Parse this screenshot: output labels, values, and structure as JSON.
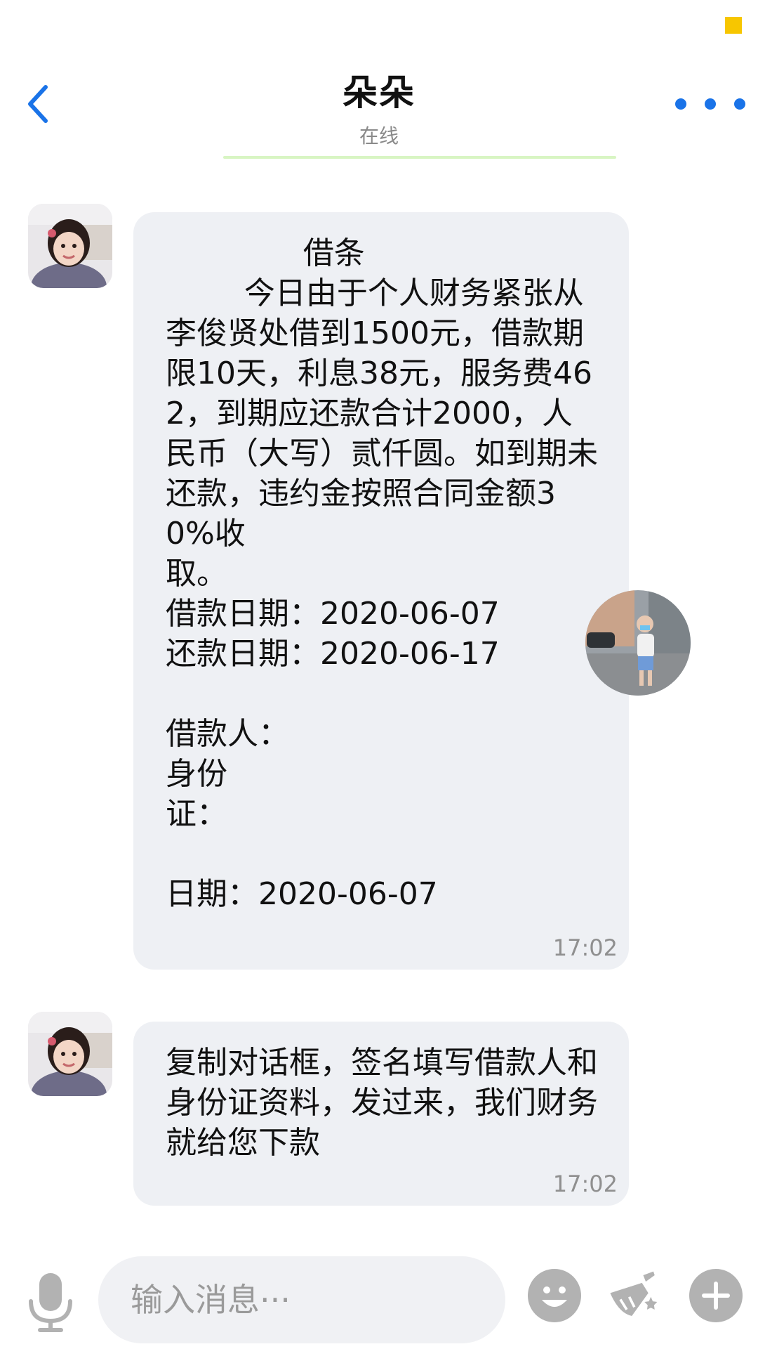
{
  "header": {
    "title": "朵朵",
    "status": "在线"
  },
  "messages": [
    {
      "text": "              借条\n        今日由于个人财务紧张从李俊贤处借到1500元，借款期限10天，利息38元，服务费462，到期应还款合计2000，人民币（大写）贰仟圆。如到期未还款，违约金按照合同金额30%收\n取。\n借款日期：2020-06-07\n还款日期：2020-06-17\n\n借款人：\n身份\n证：\n\n日期：2020-06-07",
      "time": "17:02"
    },
    {
      "text": "复制对话框，签名填写借款人和身份证资料，发过来，我们财务就给您下款",
      "time": "17:02"
    }
  ],
  "input": {
    "placeholder": "输入消息···"
  },
  "colors": {
    "accent": "#1a73e8",
    "bubble": "#eef0f4",
    "status_indicator": "#f7c600"
  },
  "icons": [
    "back-arrow-icon",
    "more-dots-icon",
    "microphone-icon",
    "emoji-icon",
    "broom-icon",
    "plus-icon"
  ]
}
